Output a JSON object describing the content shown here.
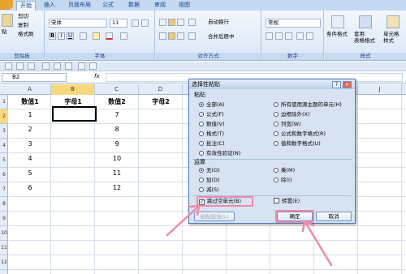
{
  "tabs": {
    "home": "开始",
    "insert": "插入",
    "layout": "页面布局",
    "formula": "公式",
    "data": "数据",
    "review": "审阅",
    "view": "视图"
  },
  "ribbon": {
    "clipboard": {
      "paste": "贴",
      "cut": "剪切",
      "copy": "复制",
      "format_painter": "格式刷",
      "label": "剪贴板"
    },
    "font": {
      "name": "宋体",
      "size": "11",
      "label": "字体",
      "bold": "B",
      "italic": "I",
      "underline": "U"
    },
    "align": {
      "wrap": "自动换行",
      "merge": "合并后居中",
      "label": "对齐方式"
    },
    "number": {
      "format": "常规",
      "label": "数字"
    },
    "styles": {
      "cond": "条件格式",
      "table": "套用\n表格格式",
      "cell": "单元格\n样式",
      "label": "样式"
    }
  },
  "namebox": "B2",
  "fx": "fx",
  "columns": [
    "A",
    "B",
    "C",
    "D",
    "E",
    "F",
    "G",
    "H",
    "I",
    "J"
  ],
  "rows": [
    "1",
    "2",
    "3",
    "4",
    "5",
    "6",
    "7",
    "8",
    "9",
    "10",
    "11",
    "12"
  ],
  "sheet": {
    "headers": [
      "数值1",
      "字母1",
      "数值2",
      "字母2"
    ],
    "col_a": [
      "1",
      "2",
      "3",
      "4",
      "5",
      "6"
    ],
    "col_c": [
      "7",
      "8",
      "9",
      "10",
      "11",
      "12"
    ]
  },
  "dialog": {
    "title": "选择性粘贴",
    "paste_label": "粘贴",
    "paste_left": [
      "全部(A)",
      "公式(F)",
      "数值(V)",
      "格式(T)",
      "批注(C)",
      "有效性验证(N)"
    ],
    "paste_right": [
      "所有使用源主题的单元(H)",
      "边框除外(X)",
      "列宽(W)",
      "公式和数字格式(R)",
      "值和数字格式(U)"
    ],
    "op_label": "运算",
    "op_left": [
      "无(O)",
      "加(D)",
      "减(S)"
    ],
    "op_right": [
      "乘(M)",
      "除(I)"
    ],
    "skip_blanks": "跳过空单元(B)",
    "transpose": "转置(E)",
    "paste_link": "粘贴链接(L)",
    "ok": "确定",
    "cancel": "取消",
    "help": "?",
    "close": "×"
  },
  "colors": {
    "accent": "#f08aa6",
    "selected": "#f8d87c",
    "ribbon": "#dbe7f6"
  }
}
